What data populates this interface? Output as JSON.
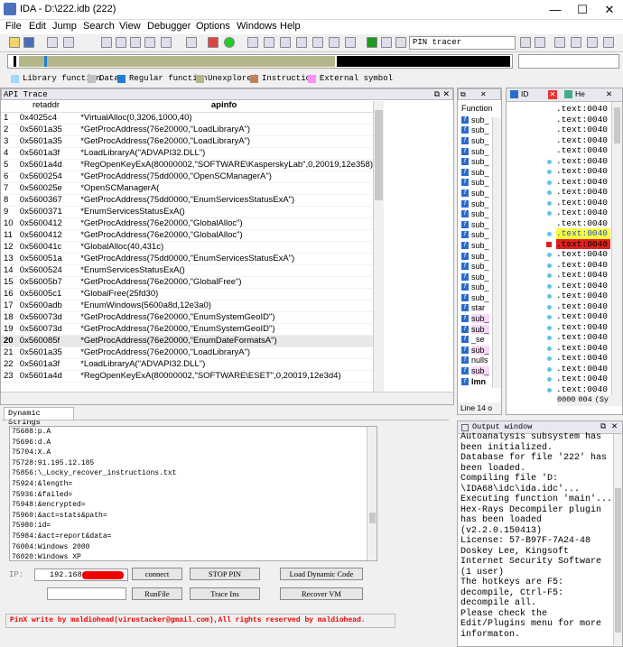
{
  "window": {
    "title": "IDA - D:\\222.idb (222)",
    "minimize": "—",
    "maximize": "☐",
    "close": "✕"
  },
  "menu": [
    "File",
    "Edit",
    "Jump",
    "Search",
    "View",
    "Debugger",
    "Options",
    "Windows",
    "Help"
  ],
  "toolbar": {
    "debugger_select": "PIN tracer"
  },
  "legend": [
    {
      "label": "Library function",
      "color": "#a0d8ff"
    },
    {
      "label": "Data",
      "color": "#c0c0c0"
    },
    {
      "label": "Regular function",
      "color": "#1f7fd6"
    },
    {
      "label": "Unexplored",
      "color": "#b5b58a"
    },
    {
      "label": "Instruction",
      "color": "#c08060"
    },
    {
      "label": "External symbol",
      "color": "#ff90ff"
    }
  ],
  "api_trace": {
    "title": "API Trace",
    "columns": [
      "",
      "retaddr",
      "apinfo"
    ],
    "rows": [
      [
        "1",
        "0x4025c4",
        "*VirtualAlloc(0,3206,1000,40)"
      ],
      [
        "2",
        "0x5601a35",
        "*GetProcAddress(76e20000,\"LoadLibraryA\")"
      ],
      [
        "3",
        "0x5601a35",
        "*GetProcAddress(76e20000,\"LoadLibraryA\")"
      ],
      [
        "4",
        "0x5601a3f",
        "*LoadLibraryA(\"ADVAPI32.DLL\")"
      ],
      [
        "5",
        "0x5601a4d",
        "*RegOpenKeyExA(80000002,\"SOFTWARE\\KasperskyLab\",0,20019,12e358)"
      ],
      [
        "6",
        "0x5600254",
        "*GetProcAddress(75dd0000,\"OpenSCManagerA\")"
      ],
      [
        "7",
        "0x560025e",
        "*OpenSCManagerA("
      ],
      [
        "8",
        "0x5600367",
        "*GetProcAddress(75dd0000,\"EnumServicesStatusExA\")"
      ],
      [
        "9",
        "0x5600371",
        "*EnumServicesStatusExA()"
      ],
      [
        "10",
        "0x5600412",
        "*GetProcAddress(76e20000,\"GlobalAlloc\")"
      ],
      [
        "11",
        "0x5600412",
        "*GetProcAddress(76e20000,\"GlobalAlloc\")"
      ],
      [
        "12",
        "0x560041c",
        "*GlobalAlloc(40,431c)"
      ],
      [
        "13",
        "0x560051a",
        "*GetProcAddress(75dd0000,\"EnumServicesStatusExA\")"
      ],
      [
        "14",
        "0x5600524",
        "*EnumServicesStatusExA()"
      ],
      [
        "15",
        "0x56005b7",
        "*GetProcAddress(76e20000,\"GlobalFree\")"
      ],
      [
        "16",
        "0x56005c1",
        "*GlobalFree(25fd30)"
      ],
      [
        "17",
        "0x5600adb",
        "*EnumWindows(5600a8d,12e3a0)"
      ],
      [
        "18",
        "0x560073d",
        "*GetProcAddress(76e20000,\"EnumSystemGeoID\")"
      ],
      [
        "19",
        "0x560073d",
        "*GetProcAddress(76e20000,\"EnumSystemGeoID\")"
      ],
      [
        "20",
        "0x560085f",
        "*GetProcAddress(76e20000,\"EnumDateFormatsA\")"
      ],
      [
        "21",
        "0x5601a35",
        "*GetProcAddress(76e20000,\"LoadLibraryA\")"
      ],
      [
        "22",
        "0x5601a3f",
        "*LoadLibraryA(\"ADVAPI32.DLL\")"
      ],
      [
        "23",
        "0x5601a4d",
        "*RegOpenKeyExA(80000002,\"SOFTWARE\\ESET\",0,20019,12e3d4)"
      ]
    ]
  },
  "functions": {
    "title": "Function",
    "items": [
      "sub_",
      "sub_",
      "sub_",
      "sub_",
      "sub_",
      "sub_",
      "sub_",
      "sub_",
      "sub_",
      "sub_",
      "sub_",
      "sub_",
      "sub_",
      "sub_",
      "sub_",
      "sub_",
      "sub_",
      "sub_",
      "star",
      "sub_",
      "sub_",
      "_se",
      "sub_",
      "nulls",
      "sub_",
      "lmn"
    ],
    "status": "Line 14 o"
  },
  "ida_view": {
    "tab1": "ID",
    "tab2": "He",
    "text": ".text:0040",
    "highlight_text": ".text:0040",
    "bp_text": ".text:0040",
    "footer_a": "0000",
    "footer_b": "004",
    "footer_c": "(Sy"
  },
  "dyn_strings": {
    "tab": "Dynamic Strings",
    "lines": [
      "75688:p.A",
      "75696:d.A",
      "75704:X.A",
      "75728:91.195.12.185",
      "75856:\\_Locky_recover_instructions.txt",
      "75924:&length=",
      "75936:&failed=",
      "75948:&encrypted=",
      "75960:&act=stats&path=",
      "75980:id=",
      "75984:&act=report&data=",
      "76004:Windows 2000",
      "76020:Windows XP",
      "76032:Windows 2003",
      "76048:Windows 2003 R2"
    ]
  },
  "controls": {
    "ip_label": "IP:",
    "ip_value": "192.168.",
    "connect": "connect",
    "stop_pin": "STOP PIN",
    "load_dynamic_code": "Load Dynamic Code",
    "runfile": "RunFile",
    "trace_ins": "Trace Ins",
    "recover_vm": "Recover VM",
    "credit": "PinX write by maldiohead(virustacker@gmail.com),All rights reserved by maldiohead."
  },
  "output": {
    "title": "Output window",
    "lines": [
      "Autoanalysis subsystem has",
      "been initialized.",
      "Database for file '222' has",
      "been loaded.",
      "Compiling file 'D:",
      "\\IDA68\\idc\\ida.idc'...",
      "Executing function 'main'...",
      "Hex-Rays Decompiler plugin",
      "has been loaded",
      "(v2.2.0.150413)",
      "  License: 57-B97F-7A24-48",
      "Doskey Lee, Kingsoft",
      "Internet Security Software",
      "(1 user)",
      "  The hotkeys are F5:",
      "decompile, Ctrl-F5:",
      "decompile all.",
      "  Please check the",
      "Edit/Plugins menu for more",
      "informaton."
    ]
  }
}
